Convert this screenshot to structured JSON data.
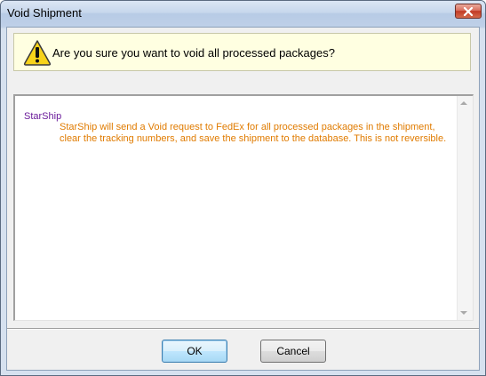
{
  "window": {
    "title": "Void Shipment"
  },
  "question": {
    "text": "Are you sure you want to void all processed packages?"
  },
  "detail": {
    "source": "StarShip",
    "message": "StarShip will send a Void request to FedEx for all processed packages in the shipment, clear the tracking numbers, and save the shipment to the database. This is not reversible."
  },
  "buttons": {
    "ok": "OK",
    "cancel": "Cancel"
  },
  "colors": {
    "detail_source": "#6a1b9a",
    "detail_message": "#e07b00",
    "info_background": "#ffffe1"
  },
  "icons": {
    "warning": "warning-icon",
    "close": "close-icon"
  }
}
